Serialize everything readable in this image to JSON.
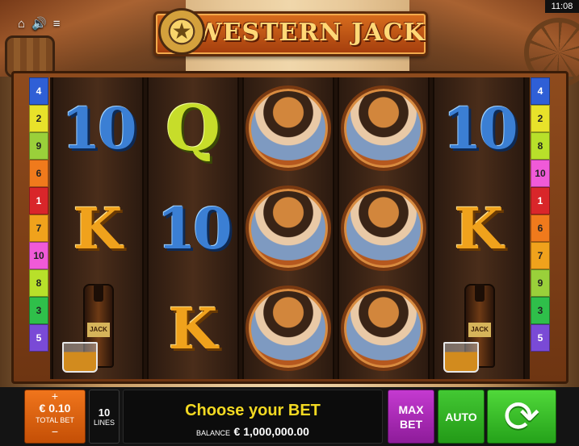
{
  "status_bar": {
    "clock": "11:08"
  },
  "top_icons": {
    "home": "⌂",
    "sound": "🔊",
    "menu": "≡"
  },
  "logo": {
    "title": "WESTERN JACK"
  },
  "paylines_left": [
    {
      "n": "4",
      "color": "#2f5fd6"
    },
    {
      "n": "2",
      "color": "#e8e22a"
    },
    {
      "n": "9",
      "color": "#9ad03a"
    },
    {
      "n": "6",
      "color": "#f07a1c"
    },
    {
      "n": "1",
      "color": "#d9262a"
    },
    {
      "n": "7",
      "color": "#f0a21c"
    },
    {
      "n": "10",
      "color": "#f05ad8"
    },
    {
      "n": "8",
      "color": "#b8e02a"
    },
    {
      "n": "3",
      "color": "#2fbf4a"
    },
    {
      "n": "5",
      "color": "#7a4ad6"
    }
  ],
  "paylines_right": [
    {
      "n": "4",
      "color": "#2f5fd6"
    },
    {
      "n": "2",
      "color": "#e8e22a"
    },
    {
      "n": "8",
      "color": "#b8e02a"
    },
    {
      "n": "10",
      "color": "#f05ad8"
    },
    {
      "n": "1",
      "color": "#d9262a"
    },
    {
      "n": "6",
      "color": "#f07a1c"
    },
    {
      "n": "7",
      "color": "#f0a21c"
    },
    {
      "n": "9",
      "color": "#9ad03a"
    },
    {
      "n": "3",
      "color": "#2fbf4a"
    },
    {
      "n": "5",
      "color": "#7a4ad6"
    }
  ],
  "reels": [
    [
      "10",
      "K",
      "whiskey"
    ],
    [
      "Q",
      "10",
      "K"
    ],
    [
      "cowgirl",
      "cowgirl",
      "cowgirl"
    ],
    [
      "cowgirl",
      "cowgirl",
      "cowgirl"
    ],
    [
      "10",
      "K",
      "whiskey"
    ]
  ],
  "controls": {
    "total_bet_value": "€ 0.10",
    "total_bet_label": "TOTAL BET",
    "plus": "+",
    "minus": "−",
    "lines_value": "10",
    "lines_label": "LINES",
    "message": "Choose your BET",
    "balance_label": "BALANCE",
    "balance_value": "€ 1,000,000.00",
    "max_bet_line1": "MAX",
    "max_bet_line2": "BET",
    "auto_label": "AUTO",
    "spin_icon": "spin-arrows-icon"
  }
}
